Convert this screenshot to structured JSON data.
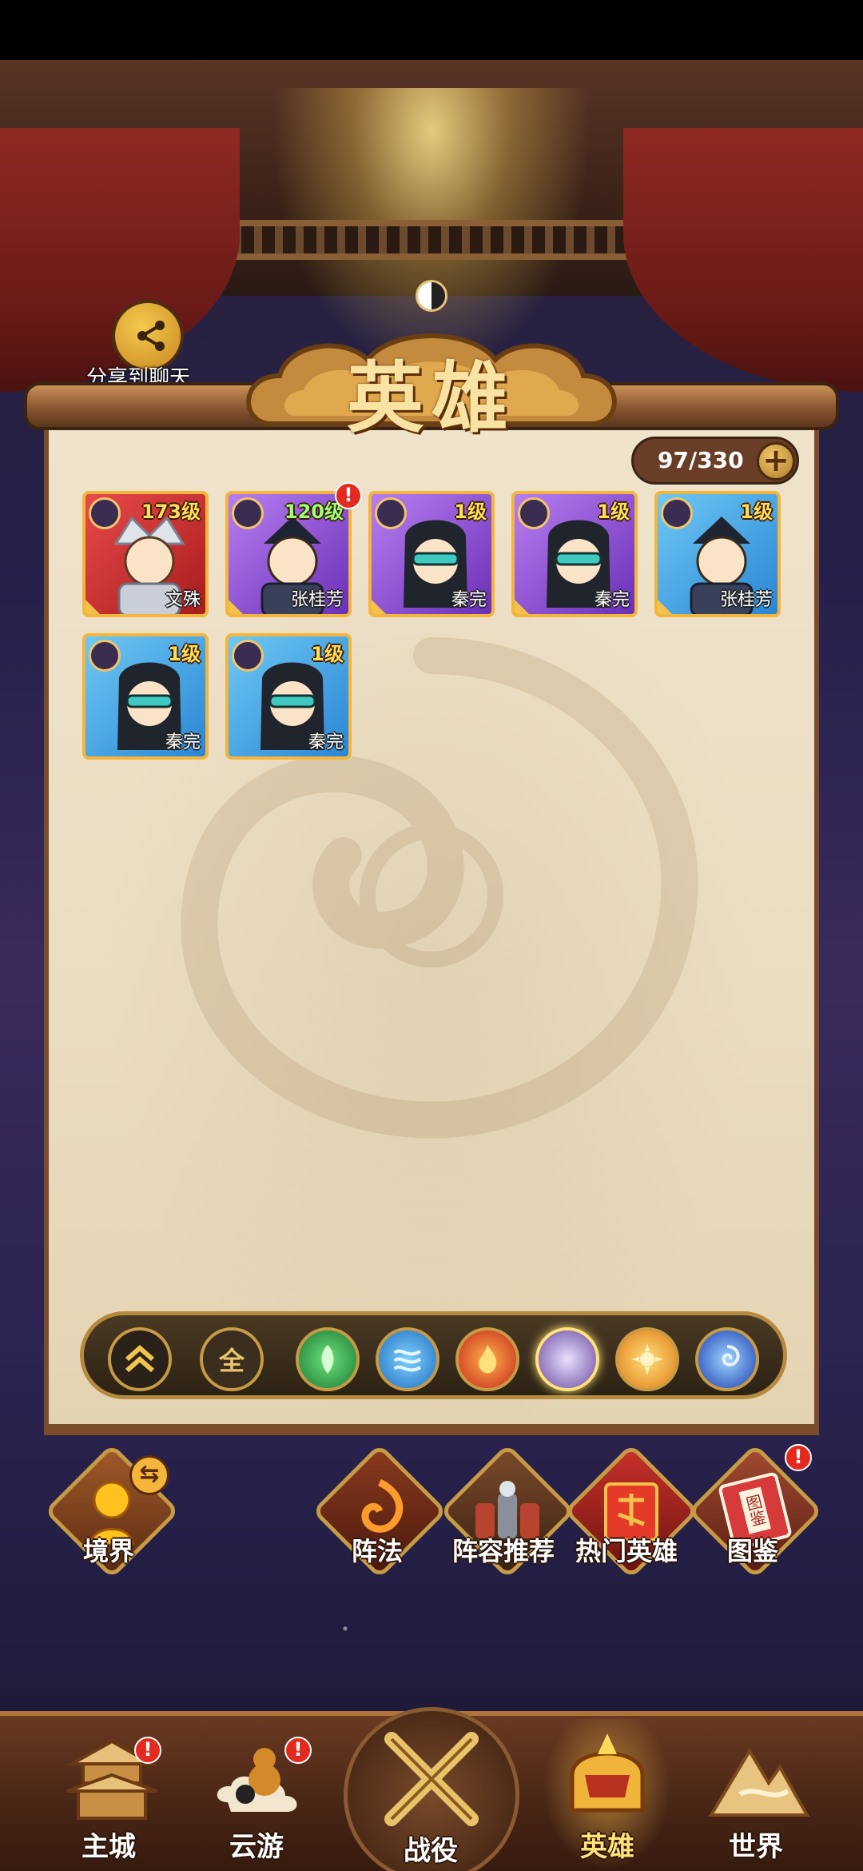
{
  "share": {
    "label": "分享到聊天",
    "icon": "share-icon"
  },
  "title": "英雄",
  "hero_count": {
    "text": "97/330",
    "add_label": "+"
  },
  "heroes": [
    {
      "name": "文殊",
      "level": "173级",
      "rarity": "red"
    },
    {
      "name": "张桂芳",
      "level": "120级",
      "rarity": "purple",
      "alert": "!"
    },
    {
      "name": "秦完",
      "level": "1级",
      "rarity": "purple"
    },
    {
      "name": "秦完",
      "level": "1级",
      "rarity": "purple"
    },
    {
      "name": "张桂芳",
      "level": "1级",
      "rarity": "blue"
    },
    {
      "name": "秦完",
      "level": "1级",
      "rarity": "blue"
    },
    {
      "name": "秦完",
      "level": "1级",
      "rarity": "blue"
    }
  ],
  "filters": {
    "collapse_icon": "double-chevron-up-icon",
    "all_label": "全",
    "elements": [
      "wood-element-icon",
      "water-element-icon",
      "fire-element-icon",
      "moon-element-icon",
      "sun-element-icon",
      "wind-element-icon"
    ]
  },
  "features": {
    "realm": {
      "label": "境界"
    },
    "formation": {
      "label": "阵法"
    },
    "lineup": {
      "label": "阵容推荐"
    },
    "hot_heroes": {
      "label": "热门英雄"
    },
    "codex": {
      "label": "图鉴",
      "alert": "!",
      "book_title": "图鉴"
    }
  },
  "nav": {
    "city": {
      "label": "主城",
      "alert": "!"
    },
    "travel": {
      "label": "云游",
      "alert": "!"
    },
    "battle": {
      "label": "战役"
    },
    "hero": {
      "label": "英雄"
    },
    "world": {
      "label": "世界"
    }
  },
  "colors": {
    "accent_gold": "#f3b53b",
    "alert_red": "#e42a1e",
    "panel_parchment": "#eadcc0",
    "level_yellow": "#ffde5a"
  }
}
